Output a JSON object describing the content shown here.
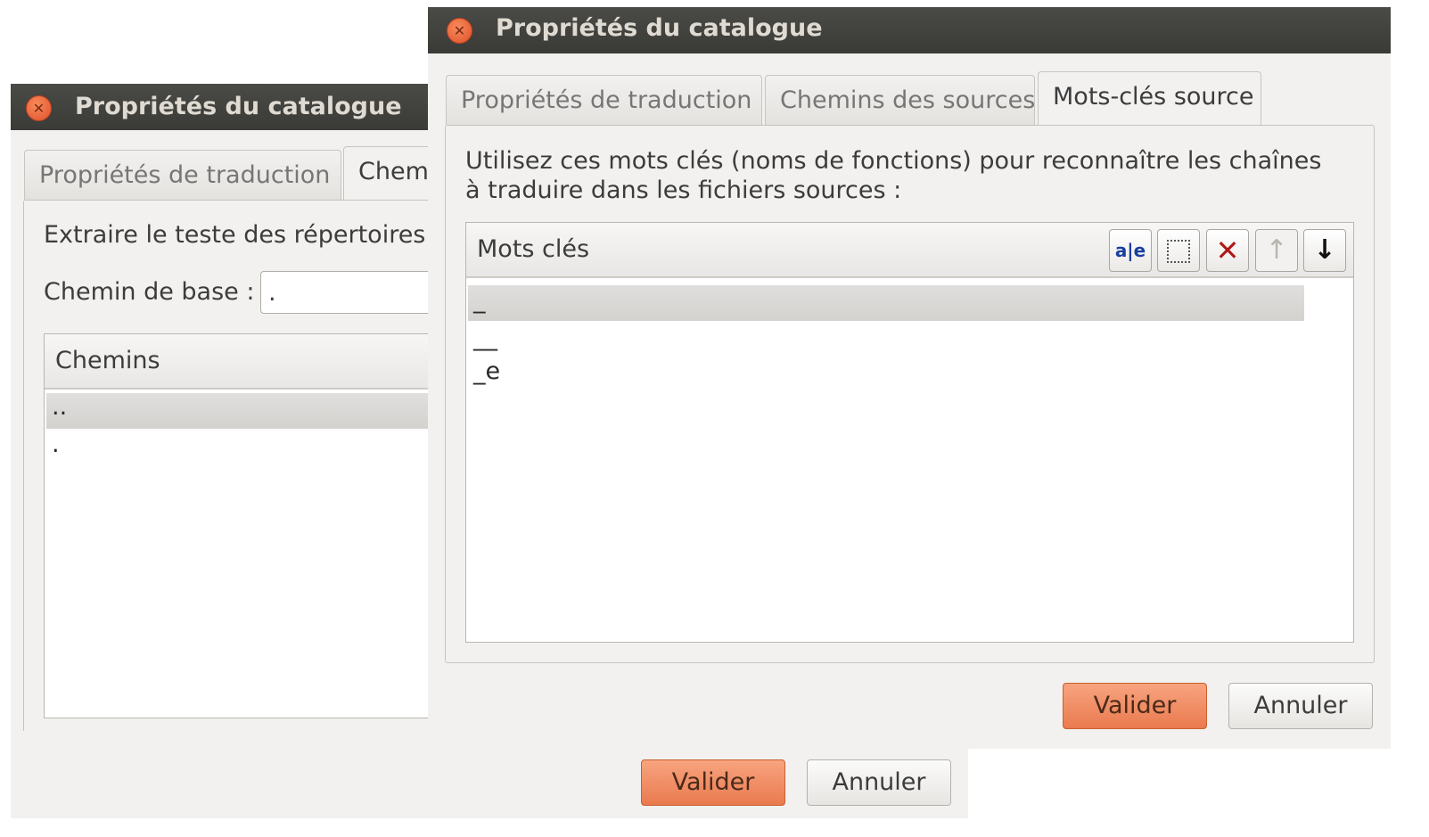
{
  "back_window": {
    "title": "Propriétés du catalogue",
    "tabs": [
      "Propriétés de traduction",
      "Chemi"
    ],
    "description": "Extraire le teste des répertoires s",
    "base_path_label": "Chemin de base :",
    "base_path_value": ".",
    "list_header": "Chemins",
    "paths": [
      "..",
      "."
    ],
    "ok_label": "Valider",
    "cancel_label": "Annuler"
  },
  "front_window": {
    "title": "Propriétés du catalogue",
    "tabs": [
      "Propriétés de traduction",
      "Chemins des sources",
      "Mots-clés source"
    ],
    "description_line1": "Utilisez ces mots clés (noms de fonctions) pour reconnaître les chaînes",
    "description_line2": "à traduire dans les fichiers sources :",
    "list_header": "Mots clés",
    "keywords": [
      "_",
      "__",
      "_e"
    ],
    "toolbar": {
      "edit_glyph": "a|e",
      "icons": [
        "edit-item-icon",
        "new-item-icon",
        "delete-icon",
        "move-up-icon",
        "move-down-icon"
      ]
    },
    "ok_label": "Valider",
    "cancel_label": "Annuler"
  },
  "colors": {
    "titlebar": "#3c3b37",
    "accent": "#ef8b5e",
    "dialog_bg": "#f2f1f0"
  }
}
